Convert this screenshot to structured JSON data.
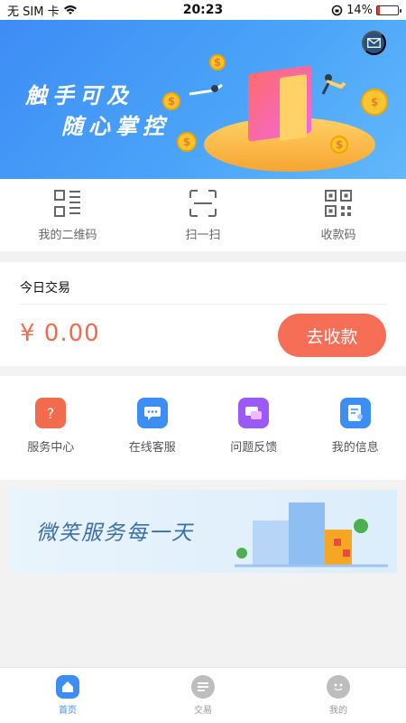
{
  "status_bar": {
    "carrier": "无 SIM 卡",
    "time": "20:23",
    "battery": "14%",
    "battery_level": 0.14
  },
  "banner": {
    "line1": "触手可及",
    "line2": "随心掌控",
    "mail_icon": "mail-icon"
  },
  "quick_actions": [
    {
      "label": "我的二维码",
      "icon": "qrcode-card-icon"
    },
    {
      "label": "扫一扫",
      "icon": "scan-icon"
    },
    {
      "label": "收款码",
      "icon": "qrcode-icon"
    }
  ],
  "today": {
    "title": "今日交易",
    "amount": "¥ 0.00",
    "button": "去收款"
  },
  "services": [
    {
      "label": "服务中心",
      "icon": "service-center-icon",
      "color": "#f26b4d"
    },
    {
      "label": "在线客服",
      "icon": "online-support-icon",
      "color": "#3c8ef5"
    },
    {
      "label": "问题反馈",
      "icon": "feedback-icon",
      "color": "#9b59f5"
    },
    {
      "label": "我的信息",
      "icon": "my-info-icon",
      "color": "#3c8ef5"
    }
  ],
  "promo": {
    "text": "微笑服务每一天"
  },
  "tabs": [
    {
      "label": "首页",
      "icon": "home-icon",
      "active": true
    },
    {
      "label": "交易",
      "icon": "transaction-icon",
      "active": false
    },
    {
      "label": "我的",
      "icon": "profile-icon",
      "active": false
    }
  ],
  "colors": {
    "accent": "#3c8ef5",
    "amount": "#f26b4d",
    "button": "#f76e57"
  }
}
